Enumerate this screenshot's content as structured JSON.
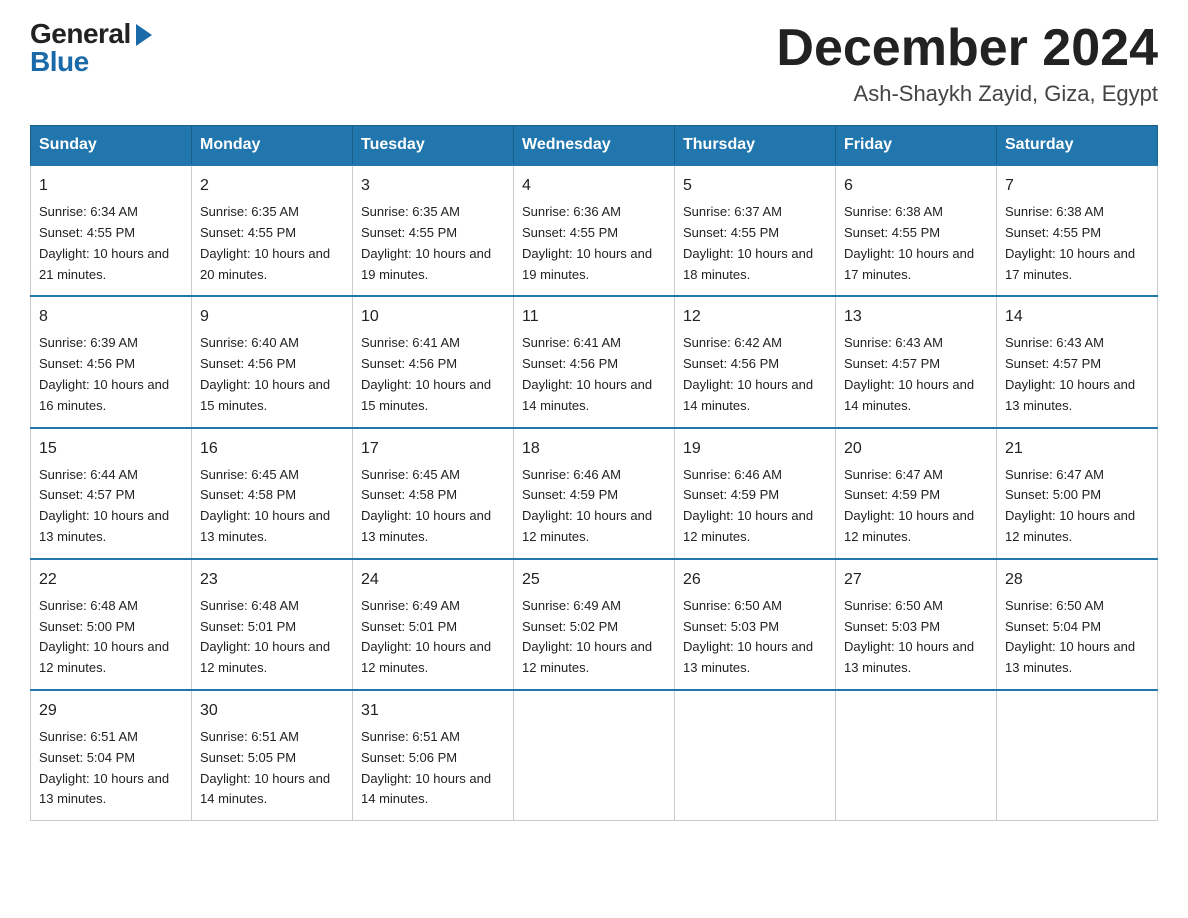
{
  "logo": {
    "general": "General",
    "blue": "Blue"
  },
  "header": {
    "month": "December 2024",
    "location": "Ash-Shaykh Zayid, Giza, Egypt"
  },
  "weekdays": [
    "Sunday",
    "Monday",
    "Tuesday",
    "Wednesday",
    "Thursday",
    "Friday",
    "Saturday"
  ],
  "weeks": [
    [
      {
        "day": "1",
        "sunrise": "6:34 AM",
        "sunset": "4:55 PM",
        "daylight": "10 hours and 21 minutes."
      },
      {
        "day": "2",
        "sunrise": "6:35 AM",
        "sunset": "4:55 PM",
        "daylight": "10 hours and 20 minutes."
      },
      {
        "day": "3",
        "sunrise": "6:35 AM",
        "sunset": "4:55 PM",
        "daylight": "10 hours and 19 minutes."
      },
      {
        "day": "4",
        "sunrise": "6:36 AM",
        "sunset": "4:55 PM",
        "daylight": "10 hours and 19 minutes."
      },
      {
        "day": "5",
        "sunrise": "6:37 AM",
        "sunset": "4:55 PM",
        "daylight": "10 hours and 18 minutes."
      },
      {
        "day": "6",
        "sunrise": "6:38 AM",
        "sunset": "4:55 PM",
        "daylight": "10 hours and 17 minutes."
      },
      {
        "day": "7",
        "sunrise": "6:38 AM",
        "sunset": "4:55 PM",
        "daylight": "10 hours and 17 minutes."
      }
    ],
    [
      {
        "day": "8",
        "sunrise": "6:39 AM",
        "sunset": "4:56 PM",
        "daylight": "10 hours and 16 minutes."
      },
      {
        "day": "9",
        "sunrise": "6:40 AM",
        "sunset": "4:56 PM",
        "daylight": "10 hours and 15 minutes."
      },
      {
        "day": "10",
        "sunrise": "6:41 AM",
        "sunset": "4:56 PM",
        "daylight": "10 hours and 15 minutes."
      },
      {
        "day": "11",
        "sunrise": "6:41 AM",
        "sunset": "4:56 PM",
        "daylight": "10 hours and 14 minutes."
      },
      {
        "day": "12",
        "sunrise": "6:42 AM",
        "sunset": "4:56 PM",
        "daylight": "10 hours and 14 minutes."
      },
      {
        "day": "13",
        "sunrise": "6:43 AM",
        "sunset": "4:57 PM",
        "daylight": "10 hours and 14 minutes."
      },
      {
        "day": "14",
        "sunrise": "6:43 AM",
        "sunset": "4:57 PM",
        "daylight": "10 hours and 13 minutes."
      }
    ],
    [
      {
        "day": "15",
        "sunrise": "6:44 AM",
        "sunset": "4:57 PM",
        "daylight": "10 hours and 13 minutes."
      },
      {
        "day": "16",
        "sunrise": "6:45 AM",
        "sunset": "4:58 PM",
        "daylight": "10 hours and 13 minutes."
      },
      {
        "day": "17",
        "sunrise": "6:45 AM",
        "sunset": "4:58 PM",
        "daylight": "10 hours and 13 minutes."
      },
      {
        "day": "18",
        "sunrise": "6:46 AM",
        "sunset": "4:59 PM",
        "daylight": "10 hours and 12 minutes."
      },
      {
        "day": "19",
        "sunrise": "6:46 AM",
        "sunset": "4:59 PM",
        "daylight": "10 hours and 12 minutes."
      },
      {
        "day": "20",
        "sunrise": "6:47 AM",
        "sunset": "4:59 PM",
        "daylight": "10 hours and 12 minutes."
      },
      {
        "day": "21",
        "sunrise": "6:47 AM",
        "sunset": "5:00 PM",
        "daylight": "10 hours and 12 minutes."
      }
    ],
    [
      {
        "day": "22",
        "sunrise": "6:48 AM",
        "sunset": "5:00 PM",
        "daylight": "10 hours and 12 minutes."
      },
      {
        "day": "23",
        "sunrise": "6:48 AM",
        "sunset": "5:01 PM",
        "daylight": "10 hours and 12 minutes."
      },
      {
        "day": "24",
        "sunrise": "6:49 AM",
        "sunset": "5:01 PM",
        "daylight": "10 hours and 12 minutes."
      },
      {
        "day": "25",
        "sunrise": "6:49 AM",
        "sunset": "5:02 PM",
        "daylight": "10 hours and 12 minutes."
      },
      {
        "day": "26",
        "sunrise": "6:50 AM",
        "sunset": "5:03 PM",
        "daylight": "10 hours and 13 minutes."
      },
      {
        "day": "27",
        "sunrise": "6:50 AM",
        "sunset": "5:03 PM",
        "daylight": "10 hours and 13 minutes."
      },
      {
        "day": "28",
        "sunrise": "6:50 AM",
        "sunset": "5:04 PM",
        "daylight": "10 hours and 13 minutes."
      }
    ],
    [
      {
        "day": "29",
        "sunrise": "6:51 AM",
        "sunset": "5:04 PM",
        "daylight": "10 hours and 13 minutes."
      },
      {
        "day": "30",
        "sunrise": "6:51 AM",
        "sunset": "5:05 PM",
        "daylight": "10 hours and 14 minutes."
      },
      {
        "day": "31",
        "sunrise": "6:51 AM",
        "sunset": "5:06 PM",
        "daylight": "10 hours and 14 minutes."
      },
      null,
      null,
      null,
      null
    ]
  ]
}
